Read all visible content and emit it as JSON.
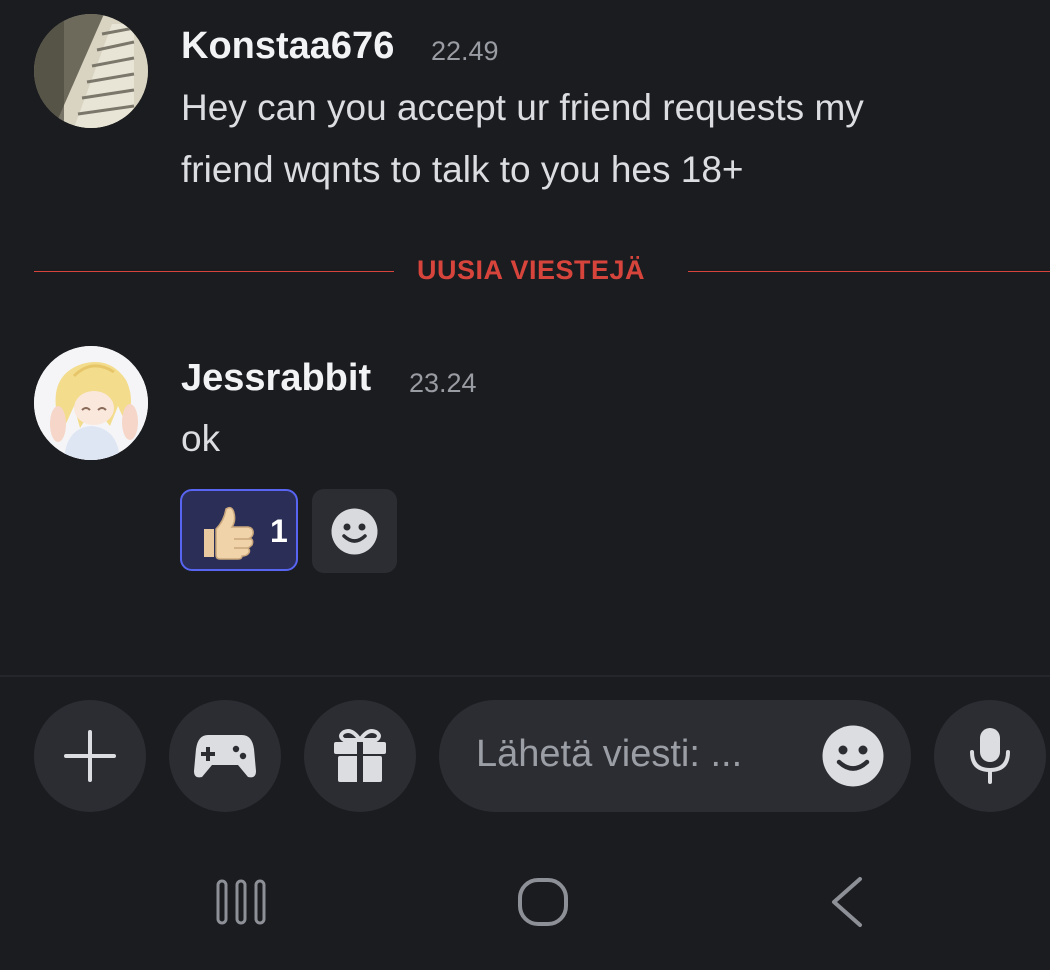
{
  "messages": [
    {
      "author": "Konstaa676",
      "time": "22.49",
      "text_lines": [
        "Hey can you accept ur friend requests my",
        "friend wqnts to talk to you hes 18+"
      ],
      "avatar_icon": "building-photo-avatar"
    },
    {
      "author": "Jessrabbit",
      "time": "23.24",
      "text": "ok",
      "avatar_icon": "anime-bunny-girl-avatar",
      "reactions": [
        {
          "emoji": "thumbs-up",
          "count": "1",
          "selected": true
        }
      ]
    }
  ],
  "new_messages_divider": "UUSIA VIESTEJÄ",
  "composer": {
    "placeholder": "Lähetä viesti: ...",
    "buttons": [
      "plus-icon",
      "gamepad-icon",
      "gift-icon",
      "emoji-icon",
      "microphone-icon"
    ]
  },
  "system_nav": [
    "recent-apps-icon",
    "home-icon",
    "back-icon"
  ],
  "colors": {
    "background": "#1b1c20",
    "divider": "#d7443b",
    "reaction_border": "#5865f2",
    "reaction_bg": "#2b2f57",
    "control_bg": "#2b2d33"
  }
}
